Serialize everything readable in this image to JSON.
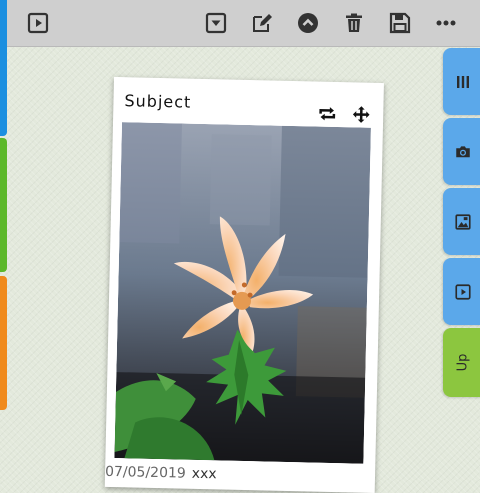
{
  "toolbar": {
    "buttons": [
      {
        "name": "play-button",
        "icon": "play-square-icon"
      },
      {
        "name": "dropdown-button",
        "icon": "dropdown-square-icon"
      },
      {
        "name": "edit-button",
        "icon": "edit-icon"
      },
      {
        "name": "collapse-button",
        "icon": "chevron-up-circle-icon"
      },
      {
        "name": "delete-button",
        "icon": "trash-icon"
      },
      {
        "name": "save-button",
        "icon": "floppy-icon"
      },
      {
        "name": "more-button",
        "icon": "more-dots-icon"
      }
    ]
  },
  "side_tabs": [
    {
      "name": "columns-tab",
      "icon": "columns-icon"
    },
    {
      "name": "camera-tab",
      "icon": "camera-icon"
    },
    {
      "name": "gallery-tab",
      "icon": "gallery-icon"
    },
    {
      "name": "video-tab",
      "icon": "play-square-icon"
    },
    {
      "name": "up-tab",
      "label": "Up"
    }
  ],
  "card": {
    "title": "Subject",
    "date": "07/05/2019",
    "description": "xxx",
    "photo_alt": "lily flower"
  },
  "colors": {
    "toolbar_bg": "#cfcfcf",
    "tab_blue": "#5ba8ea",
    "tab_green": "#8cc63f",
    "strip_blue": "#1b8fe0",
    "strip_green": "#5cb82a",
    "strip_orange": "#f08a1c"
  }
}
